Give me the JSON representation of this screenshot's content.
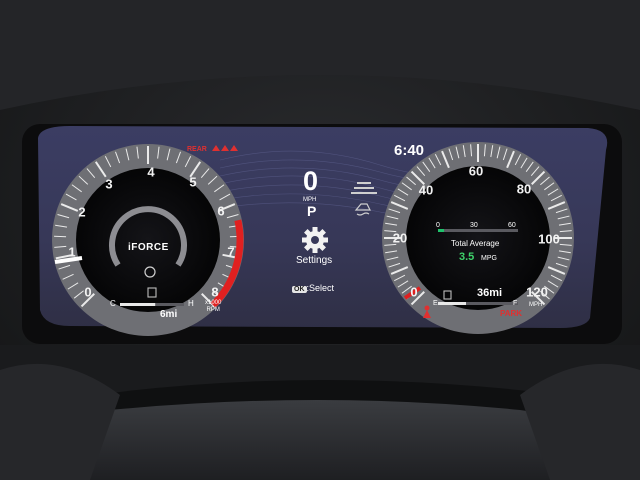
{
  "tachometer": {
    "ticks": [
      "0",
      "1",
      "2",
      "3",
      "4",
      "5",
      "6",
      "7",
      "8"
    ],
    "unit_label": "x1000\nRPM",
    "brand": "iFORCE",
    "temp_low": "C",
    "temp_high": "H",
    "trip": "6mi",
    "redline_start": 6.3,
    "temp_level": 0.55
  },
  "center": {
    "rear_label": "REAR",
    "speed": "0",
    "speed_unit": "MPH",
    "gear": "P",
    "menu_label": "Settings",
    "ok_key": "OK",
    "ok_action": ":Select"
  },
  "speedometer": {
    "ticks": [
      "0",
      "20",
      "40",
      "60",
      "80",
      "100",
      "120"
    ],
    "unit": "MPH",
    "mpg_scale": [
      "0",
      "30",
      "60"
    ],
    "mpg_title": "Total Average",
    "mpg_value": "3.5",
    "mpg_unit": "MPG",
    "fuel_empty": "E",
    "fuel_full": "F",
    "range": "36mi",
    "park_label": "PARK",
    "fuel_level": 0.35
  },
  "clock": "6:40",
  "colors": {
    "display_bg": "#39395a",
    "redline": "#e02020",
    "mpg_value": "#3ed16a",
    "accent_green": "#1fc26b",
    "warning_red": "#e03030"
  }
}
